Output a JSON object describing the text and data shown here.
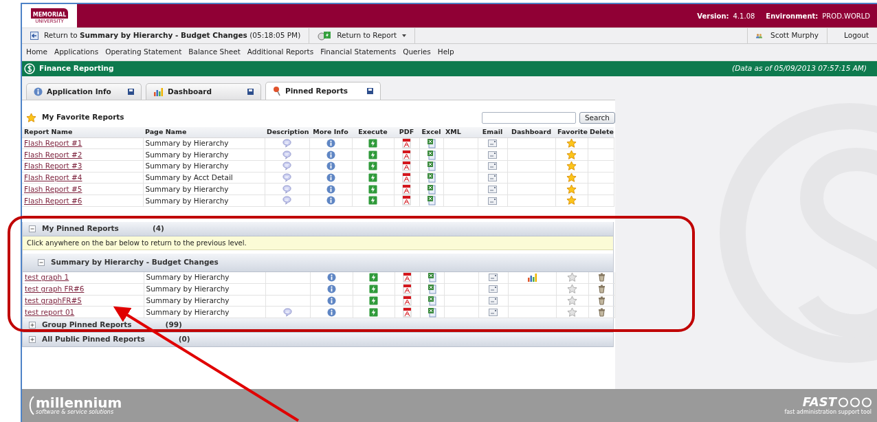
{
  "header": {
    "logo_line1": "MEMORIAL",
    "logo_line2": "UNIVERSITY",
    "version_label": "Version:",
    "version": "4.1.08",
    "environment_label": "Environment:",
    "environment": "PROD.WORLD"
  },
  "toolbar": {
    "return_text": "Return to **Summary by Hierarchy - Budget Changes** (05:18:05 PM)",
    "return_report": "Return to Report",
    "user": "Scott Murphy",
    "logout": "Logout"
  },
  "menu": [
    "Home",
    "Applications",
    "Operating Statement",
    "Balance Sheet",
    "Additional Reports",
    "Financial Statements",
    "Queries",
    "Help"
  ],
  "app_bar": {
    "title": "Finance Reporting",
    "data_as_of": "(Data as of 05/09/2013 07:57:15 AM)"
  },
  "tabs": [
    {
      "label": "Application Info",
      "kind": "info",
      "selected": false
    },
    {
      "label": "Dashboard",
      "kind": "chart",
      "selected": false
    },
    {
      "label": "Pinned Reports",
      "kind": "pin",
      "selected": true
    }
  ],
  "favorites": {
    "title": "My Favorite Reports",
    "search_button": "Search",
    "columns": [
      "Report Name",
      "Page Name",
      "Description",
      "More Info",
      "Execute",
      "PDF",
      "Excel",
      "XML",
      "Email",
      "Dashboard",
      "Favorite",
      "Delete"
    ],
    "rows": [
      {
        "report": "Flash Report #1",
        "page": "Summary by Hierarchy",
        "description": true,
        "dashboard": false,
        "favorite": true,
        "delete": false
      },
      {
        "report": "Flash Report #2",
        "page": "Summary by Hierarchy",
        "description": true,
        "dashboard": false,
        "favorite": true,
        "delete": false
      },
      {
        "report": "Flash Report #3",
        "page": "Summary by Hierarchy",
        "description": true,
        "dashboard": false,
        "favorite": true,
        "delete": false
      },
      {
        "report": "Flash Report #4",
        "page": "Summary by Acct Detail",
        "description": true,
        "dashboard": false,
        "favorite": true,
        "delete": false
      },
      {
        "report": "Flash Report #5",
        "page": "Summary by Hierarchy",
        "description": true,
        "dashboard": false,
        "favorite": true,
        "delete": false
      },
      {
        "report": "Flash Report #6",
        "page": "Summary by Hierarchy",
        "description": true,
        "dashboard": false,
        "favorite": true,
        "delete": false
      }
    ]
  },
  "pinned": {
    "title": "My Pinned Reports",
    "count": "(4)",
    "expanded": true,
    "notice": "Click anywhere on the bar below to return to the previous level.",
    "group": {
      "title": "Summary by Hierarchy - Budget Changes",
      "expanded": true
    },
    "rows": [
      {
        "report": "test graph 1",
        "page": "Summary by Hierarchy",
        "description": false,
        "dashboard": true,
        "favorite": false,
        "delete": true
      },
      {
        "report": "test graph FR#6",
        "page": "Summary by Hierarchy",
        "description": false,
        "dashboard": false,
        "favorite": false,
        "delete": true
      },
      {
        "report": "test graphFR#5",
        "page": "Summary by Hierarchy",
        "description": false,
        "dashboard": false,
        "favorite": false,
        "delete": true
      },
      {
        "report": "test report 01",
        "page": "Summary by Hierarchy",
        "description": true,
        "dashboard": false,
        "favorite": false,
        "delete": true
      }
    ]
  },
  "other_sections": [
    {
      "title": "Group Pinned Reports",
      "count": "(99)",
      "expanded": false
    },
    {
      "title": "All Public Pinned Reports",
      "count": "(0)",
      "expanded": false
    }
  ],
  "footer": {
    "left_logo": "millennium",
    "left_tagline": "software & service solutions",
    "right_logo": "FAST",
    "right_tagline": "fast administration support tool"
  }
}
